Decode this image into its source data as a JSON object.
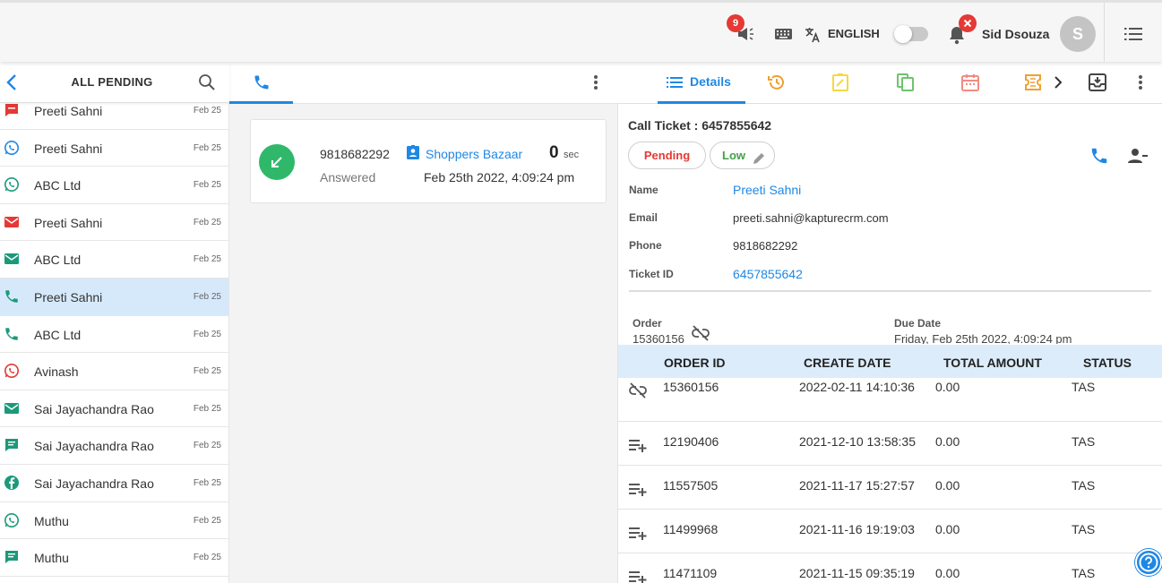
{
  "header": {
    "announcement_count": "9",
    "language": "ENGLISH",
    "user_name": "Sid Dsouza",
    "avatar_initial": "S"
  },
  "left_panel": {
    "title": "ALL PENDING",
    "items": [
      {
        "name": "Preeti Sahni",
        "date": "Feb 25",
        "channel": "ticket-icon",
        "color": "#e53935"
      },
      {
        "name": "Preeti Sahni",
        "date": "Feb 25",
        "channel": "whatsapp-icon",
        "color": "#1e88e5"
      },
      {
        "name": "ABC Ltd",
        "date": "Feb 25",
        "channel": "whatsapp-icon",
        "color": "#1b9a7a"
      },
      {
        "name": "Preeti Sahni",
        "date": "Feb 25",
        "channel": "email-icon",
        "color": "#e53935"
      },
      {
        "name": "ABC Ltd",
        "date": "Feb 25",
        "channel": "email-icon",
        "color": "#1b9a7a"
      },
      {
        "name": "Preeti Sahni",
        "date": "Feb 25",
        "channel": "phone-icon",
        "color": "#1b9a7a"
      },
      {
        "name": "ABC Ltd",
        "date": "Feb 25",
        "channel": "phone-icon",
        "color": "#1b9a7a"
      },
      {
        "name": "Avinash",
        "date": "Feb 25",
        "channel": "whatsapp-icon",
        "color": "#e53935"
      },
      {
        "name": "Sai Jayachandra Rao",
        "date": "Feb 25",
        "channel": "email-icon",
        "color": "#1b9a7a"
      },
      {
        "name": "Sai Jayachandra Rao",
        "date": "Feb 25",
        "channel": "chat-icon",
        "color": "#1b9a7a"
      },
      {
        "name": "Sai Jayachandra Rao",
        "date": "Feb 25",
        "channel": "facebook-icon",
        "color": "#1b9a7a"
      },
      {
        "name": "Muthu",
        "date": "Feb 25",
        "channel": "whatsapp-icon",
        "color": "#1b9a7a"
      },
      {
        "name": "Muthu",
        "date": "Feb 25",
        "channel": "chat-icon",
        "color": "#1b9a7a"
      }
    ]
  },
  "call_card": {
    "number": "9818682292",
    "status": "Answered",
    "company": "Shoppers Bazaar",
    "duration_value": "0",
    "duration_unit": "sec",
    "timestamp": "Feb 25th 2022, 4:09:24 pm"
  },
  "details": {
    "tab_label": "Details",
    "ticket_title": "Call Ticket : 6457855642",
    "status_pill": "Pending",
    "priority_pill": "Low",
    "fields": [
      {
        "label": "Name",
        "value": "Preeti Sahni"
      },
      {
        "label": "Email",
        "value": "preeti.sahni@kapturecrm.com"
      },
      {
        "label": "Phone",
        "value": "9818682292"
      },
      {
        "label": "Ticket ID",
        "value": "6457855642"
      }
    ],
    "order_label": "Order",
    "order_value": "15360156",
    "due_label": "Due Date",
    "due_value": "Friday, Feb 25th 2022, 4:09:24 pm"
  },
  "orders_table": {
    "headers": [
      "ORDER ID",
      "CREATE DATE",
      "TOTAL AMOUNT",
      "STATUS"
    ],
    "rows": [
      {
        "id": "15360156",
        "date": "2022-02-11 14:10:36",
        "amount": "0.00",
        "status": "TAS",
        "icon": "unlink-icon"
      },
      {
        "id": "12190406",
        "date": "2021-12-10 13:58:35",
        "amount": "0.00",
        "status": "TAS",
        "icon": "playlist-add-icon"
      },
      {
        "id": "11557505",
        "date": "2021-11-17 15:27:57",
        "amount": "0.00",
        "status": "TAS",
        "icon": "playlist-add-icon"
      },
      {
        "id": "11499968",
        "date": "2021-11-16 19:19:03",
        "amount": "0.00",
        "status": "TAS",
        "icon": "playlist-add-icon"
      },
      {
        "id": "11471109",
        "date": "2021-11-15 09:35:19",
        "amount": "0.00",
        "status": "TAS",
        "icon": "playlist-add-icon"
      }
    ]
  },
  "colors": {
    "accent": "#1e88e5",
    "pending": "#e53935",
    "low": "#43a047",
    "answered_call": "#2fb86a"
  }
}
